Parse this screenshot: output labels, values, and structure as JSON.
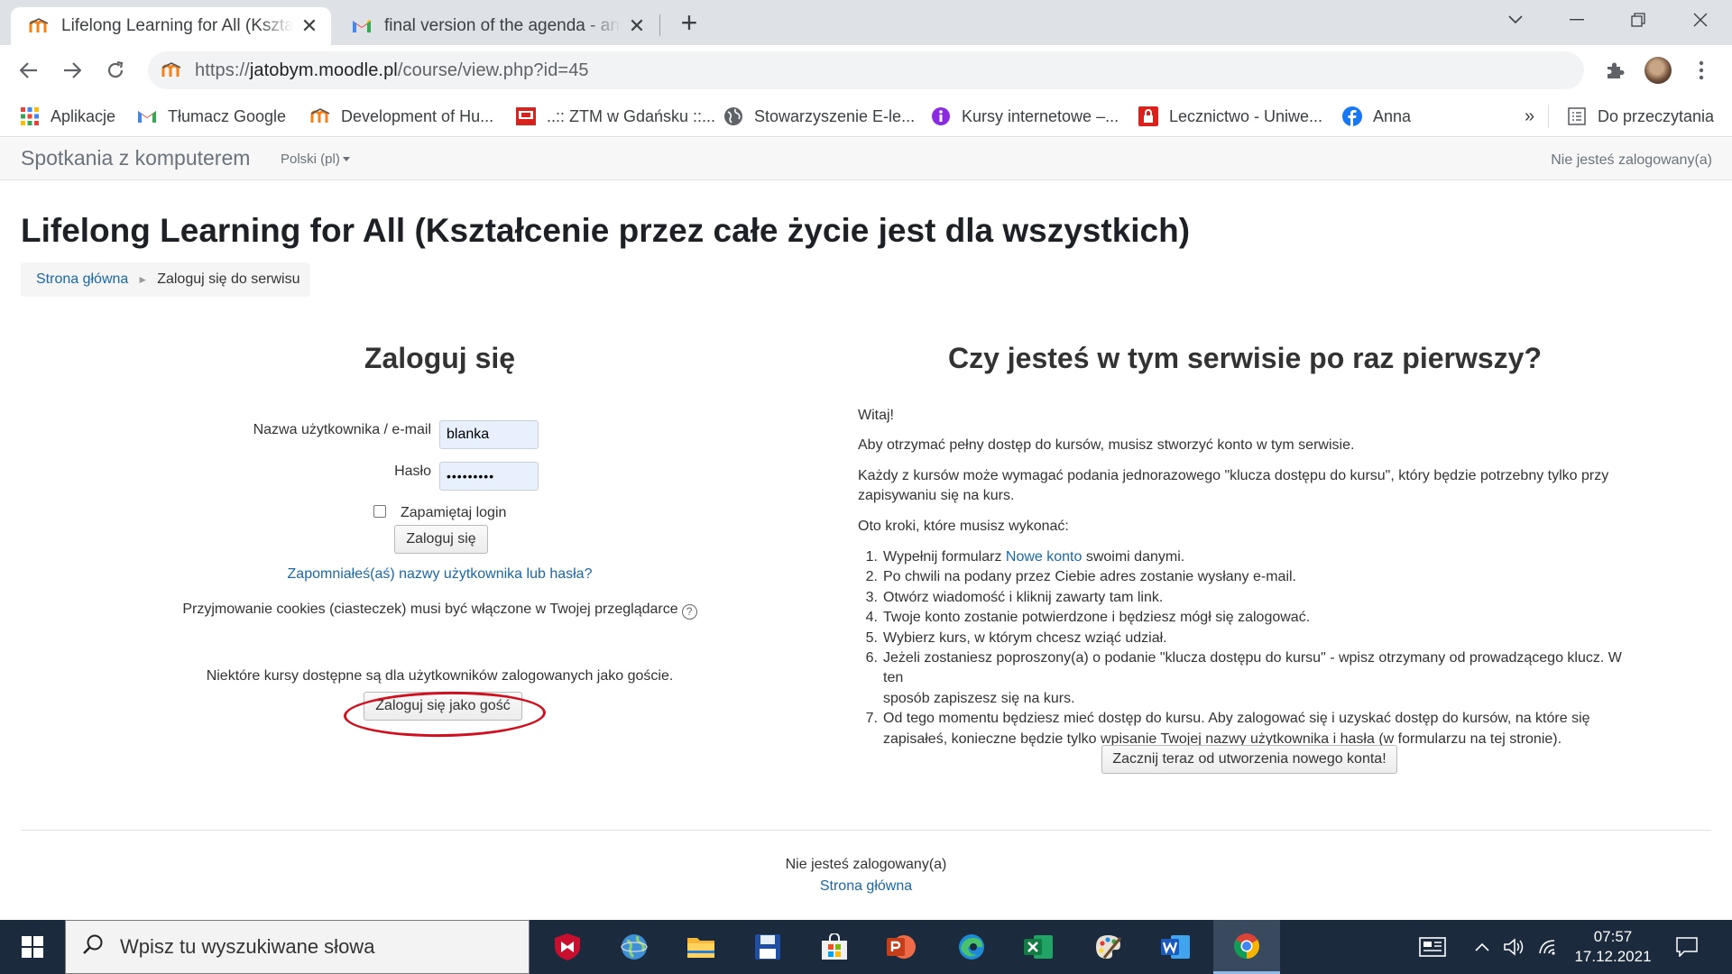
{
  "browser": {
    "tabs": [
      {
        "title": "Lifelong Learning for All (Kształcenie przez całe życie jest dla wszystkich)",
        "active": true
      },
      {
        "title": "final version of the agenda - ankieta",
        "active": false
      }
    ],
    "url_prefix": "https://",
    "url_host": "jatobym.moodle.pl",
    "url_path": "/course/view.php?id=45",
    "bookmarks": [
      "Aplikacje",
      "Tłumacz Google",
      "Development of Hu...",
      "..:: ZTM w Gdańsku ::...",
      "Stowarzyszenie E-le...",
      "Kursy internetowe –...",
      "Lecznictwo - Uniwe...",
      "Anna"
    ],
    "bookmarks_more": "»",
    "reading_list": "Do przeczytania"
  },
  "moodle": {
    "site_name": "Spotkania z komputerem",
    "language": "Polski (pl)",
    "nav_login_status": "Nie jesteś zalogowany(a)",
    "page_title": "Lifelong Learning for All (Kształcenie przez całe życie jest dla wszystkich)",
    "breadcrumb": {
      "home": "Strona główna",
      "separator": "►",
      "current": "Zaloguj się do serwisu"
    }
  },
  "login": {
    "heading": "Zaloguj się",
    "username_label": "Nazwa użytkownika / e-mail",
    "username_value": "blanka",
    "password_label": "Hasło",
    "password_value": "•••••••••",
    "remember_label": "Zapamiętaj login",
    "login_button": "Zaloguj się",
    "forgot_link": "Zapomniałeś(aś) nazwy użytkownika lub hasła?",
    "cookies_notice": "Przyjmowanie cookies (ciasteczek) musi być włączone w Twojej przeglądarce",
    "guest_notice": "Niektóre kursy dostępne są dla użytkowników zalogowanych jako goście.",
    "guest_button": "Zaloguj się jako gość"
  },
  "signup": {
    "heading": "Czy jesteś w tym serwisie po raz pierwszy?",
    "greeting": "Witaj!",
    "para1": "Aby otrzymać pełny dostęp do kursów, musisz stworzyć konto w tym serwisie.",
    "para2_line1": "Każdy z kursów może wymagać podania jednorazowego \"klucza dostępu do kursu\", który będzie potrzebny tylko przy",
    "para2_line2": "zapisywaniu się na kurs.",
    "steps_intro": "Oto kroki, które musisz wykonać:",
    "step1_before": "Wypełnij formularz ",
    "step1_link": "Nowe konto",
    "step1_after": " swoimi danymi.",
    "step2": "Po chwili na podany przez Ciebie adres zostanie wysłany e-mail.",
    "step3": "Otwórz wiadomość i kliknij zawarty tam link.",
    "step4": "Twoje konto zostanie potwierdzone i będziesz mógł się zalogować.",
    "step5": "Wybierz kurs, w którym chcesz wziąć udział.",
    "step6_line1": "Jeżeli zostaniesz poproszony(a) o podanie \"klucza dostępu do kursu\" - wpisz otrzymany od prowadzącego klucz. W ten",
    "step6_line2": "sposób zapiszesz się na kurs.",
    "step7_line1": "Od tego momentu będziesz mieć dostęp do kursu. Aby zalogować się i uzyskać dostęp do kursów, na które się",
    "step7_line2": "zapisałeś, konieczne będzie tylko wpisanie Twojej nazwy użytkownika i hasła (w formularzu na tej stronie).",
    "signup_button": "Zacznij teraz od utworzenia nowego konta!"
  },
  "footer": {
    "login_status": "Nie jesteś zalogowany(a)",
    "home_link": "Strona główna"
  },
  "taskbar": {
    "search_placeholder": "Wpisz tu wyszukiwane słowa",
    "time": "07:57",
    "date": "17.12.2021"
  },
  "colors": {
    "link": "#1a68a6",
    "annotation_ellipse": "#d0101e",
    "taskbar": "#1b2a3d"
  }
}
